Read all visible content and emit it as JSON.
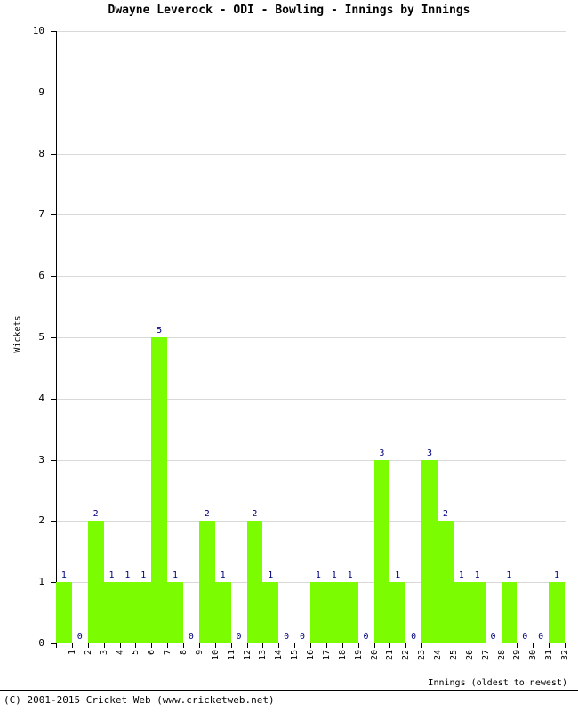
{
  "chart_data": {
    "type": "bar",
    "title": "Dwayne Leverock - ODI - Bowling - Innings by Innings",
    "xlabel": "Innings (oldest to newest)",
    "ylabel": "Wickets",
    "ylim": [
      0,
      10
    ],
    "yticks": [
      "0",
      "1",
      "2",
      "3",
      "4",
      "5",
      "6",
      "7",
      "8",
      "9",
      "10"
    ],
    "grid": true,
    "legend": null,
    "bar_color": "#7CFC00",
    "label_color": "#000080",
    "categories": [
      "1",
      "2",
      "3",
      "4",
      "5",
      "6",
      "7",
      "8",
      "9",
      "10",
      "11",
      "12",
      "13",
      "14",
      "15",
      "16",
      "17",
      "18",
      "19",
      "20",
      "21",
      "22",
      "23",
      "24",
      "25",
      "26",
      "27",
      "28",
      "29",
      "30",
      "31",
      "32"
    ],
    "values": [
      1,
      0,
      2,
      1,
      1,
      1,
      5,
      1,
      0,
      2,
      1,
      0,
      2,
      1,
      0,
      0,
      1,
      1,
      1,
      0,
      3,
      1,
      0,
      3,
      2,
      1,
      1,
      0,
      1,
      0,
      0,
      1
    ],
    "data_labels": [
      "1",
      "0",
      "2",
      "1",
      "1",
      "1",
      "5",
      "1",
      "0",
      "2",
      "1",
      "0",
      "2",
      "1",
      "0",
      "0",
      "1",
      "1",
      "1",
      "0",
      "3",
      "1",
      "0",
      "3",
      "2",
      "1",
      "1",
      "0",
      "1",
      "0",
      "0",
      "1"
    ]
  },
  "footer": {
    "copyright": "(C) 2001-2015 Cricket Web (www.cricketweb.net)"
  }
}
